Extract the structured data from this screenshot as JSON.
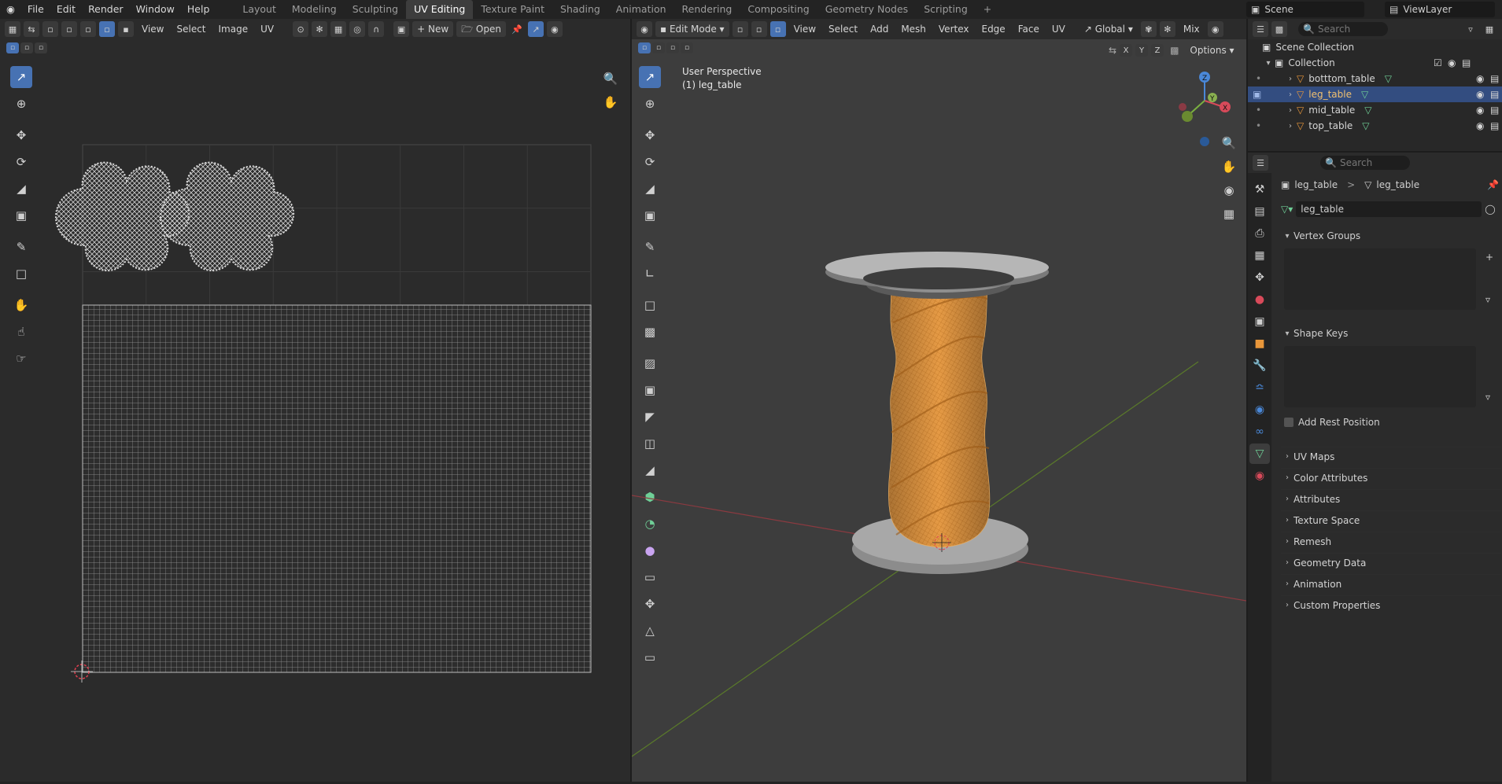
{
  "menu": {
    "file": "File",
    "edit": "Edit",
    "render": "Render",
    "window": "Window",
    "help": "Help"
  },
  "workspaces": [
    "Layout",
    "Modeling",
    "Sculpting",
    "UV Editing",
    "Texture Paint",
    "Shading",
    "Animation",
    "Rendering",
    "Compositing",
    "Geometry Nodes",
    "Scripting"
  ],
  "active_workspace": "UV Editing",
  "add_workspace": "+",
  "scene": {
    "label": "Scene",
    "viewlayer": "ViewLayer"
  },
  "uv_editor": {
    "menus": {
      "view": "View",
      "select": "Select",
      "image": "Image",
      "uv": "UV"
    },
    "new_label": "New",
    "open_label": "Open",
    "new_prefix": "+"
  },
  "viewport": {
    "mode": "Edit Mode",
    "menus": {
      "view": "View",
      "select": "Select",
      "add": "Add",
      "mesh": "Mesh",
      "vertex": "Vertex",
      "edge": "Edge",
      "face": "Face",
      "uv": "UV"
    },
    "orientation": "Global",
    "snap_mode": "Mix",
    "options": "Options",
    "axis": {
      "x": "X",
      "y": "Y",
      "z": "Z"
    },
    "overlay_title": "User Perspective",
    "overlay_object": "(1) leg_table",
    "colors": {
      "mesh": "#e8963a",
      "grid_red": "#8b3a40",
      "grid_green": "#5a7a2a"
    }
  },
  "outliner": {
    "search_placeholder": "Search",
    "scene_collection": "Scene Collection",
    "collection": "Collection",
    "objects": [
      "botttom_table",
      "leg_table",
      "mid_table",
      "top_table"
    ],
    "selected": "leg_table"
  },
  "properties": {
    "search_placeholder": "Search",
    "breadcrumb_object": "leg_table",
    "breadcrumb_sep": ">",
    "breadcrumb_data": "leg_table",
    "datablock": "leg_table",
    "vertex_groups": "Vertex Groups",
    "shape_keys": "Shape Keys",
    "add_rest_position": "Add Rest Position",
    "sections": [
      "UV Maps",
      "Color Attributes",
      "Attributes",
      "Texture Space",
      "Remesh",
      "Geometry Data",
      "Animation",
      "Custom Properties"
    ]
  }
}
